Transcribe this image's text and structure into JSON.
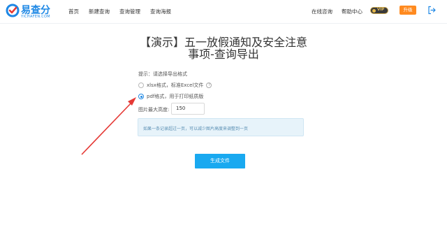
{
  "logo": {
    "text": "易查分",
    "subtext": "YICHAFEN.COM"
  },
  "nav": [
    {
      "label": "首页"
    },
    {
      "label": "新建查询"
    },
    {
      "label": "查询管理"
    },
    {
      "label": "查询海报"
    }
  ],
  "right_nav": {
    "contact": "在线咨询",
    "help": "帮助中心",
    "vip_badge": "VIP",
    "upgrade": "升级"
  },
  "icons": {
    "logout": "logout-icon",
    "help": "question-circle-icon"
  },
  "page": {
    "title": "【演示】五一放假通知及安全注意事项-查询导出",
    "hint": "提示：请选择导出格式",
    "options": [
      {
        "label": "xlsx格式，标准Excel文件",
        "selected": false
      },
      {
        "label": "pdf格式，用于打印纸质版",
        "selected": true
      }
    ],
    "height_label": "图片最大高度:",
    "height_value": "150",
    "notice": "如果一条记录超过一页，可以减少图片高度来调整到一页",
    "generate_button": "生成文件"
  },
  "colors": {
    "brand": "#1e88e5",
    "upgrade": "#ff8a1f",
    "primary_button": "#19a9f0",
    "notice_bg": "#e7f3fa",
    "annotation_arrow": "#e53935"
  }
}
